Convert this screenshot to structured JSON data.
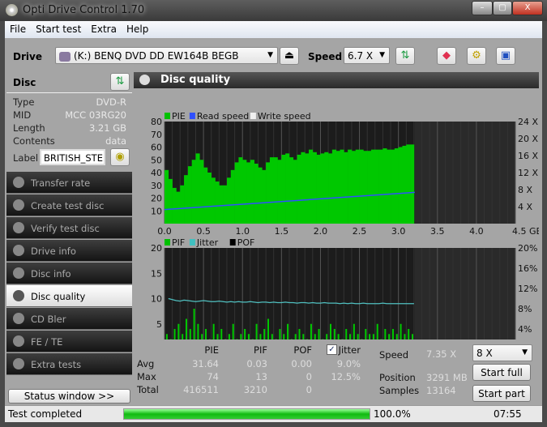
{
  "window": {
    "title": "Opti Drive Control 1.70",
    "min": "–",
    "max": "▢",
    "close": "X"
  },
  "menu": [
    "File",
    "Start test",
    "Extra",
    "Help"
  ],
  "toolbar": {
    "drive_label": "Drive",
    "drive_value": "(K:)   BENQ DVD DD EW164B BEGB",
    "speed_label": "Speed",
    "speed_value": "6.7 X"
  },
  "disc": {
    "title": "Disc",
    "rows": [
      {
        "k": "Type",
        "v": "DVD-R"
      },
      {
        "k": "MID",
        "v": "MCC 03RG20"
      },
      {
        "k": "Length",
        "v": "3.21 GB"
      },
      {
        "k": "Contents",
        "v": "data"
      }
    ],
    "label_label": "Label",
    "label_value": "BRITISH_STEEL"
  },
  "sidebar": {
    "items": [
      {
        "label": "Transfer rate"
      },
      {
        "label": "Create test disc"
      },
      {
        "label": "Verify test disc"
      },
      {
        "label": "Drive info"
      },
      {
        "label": "Disc info"
      },
      {
        "label": "Disc quality",
        "selected": true
      },
      {
        "label": "CD Bler"
      },
      {
        "label": "FE / TE"
      },
      {
        "label": "Extra tests"
      }
    ],
    "status_window": "Status window >>"
  },
  "panel": {
    "title": "Disc quality"
  },
  "chart_data": [
    {
      "type": "bar",
      "legend": [
        {
          "name": "PIE",
          "color": "#00c000"
        },
        {
          "name": "Read speed",
          "color": "#3050ff"
        },
        {
          "name": "Write speed",
          "color": "#f0f0f0"
        }
      ],
      "x": [
        0.05,
        0.1,
        0.15,
        0.2,
        0.25,
        0.3,
        0.35,
        0.4,
        0.45,
        0.5,
        0.55,
        0.6,
        0.65,
        0.7,
        0.75,
        0.8,
        0.85,
        0.9,
        0.95,
        1.0,
        1.05,
        1.1,
        1.15,
        1.2,
        1.25,
        1.3,
        1.35,
        1.4,
        1.45,
        1.5,
        1.55,
        1.6,
        1.65,
        1.7,
        1.75,
        1.8,
        1.85,
        1.9,
        1.95,
        2.0,
        2.05,
        2.1,
        2.15,
        2.2,
        2.25,
        2.3,
        2.35,
        2.4,
        2.45,
        2.5,
        2.55,
        2.6,
        2.65,
        2.7,
        2.75,
        2.8,
        2.85,
        2.9,
        2.95,
        3.0,
        3.05,
        3.1,
        3.15,
        3.2
      ],
      "pie": [
        42,
        35,
        28,
        25,
        30,
        38,
        45,
        50,
        55,
        50,
        44,
        40,
        36,
        33,
        30,
        30,
        36,
        42,
        48,
        52,
        50,
        48,
        50,
        47,
        44,
        42,
        48,
        52,
        52,
        50,
        54,
        55,
        52,
        50,
        54,
        56,
        55,
        58,
        56,
        54,
        55,
        56,
        55,
        58,
        57,
        58,
        56,
        58,
        57,
        58,
        58,
        57,
        57,
        58,
        58,
        58,
        59,
        58,
        58,
        59,
        60,
        61,
        62,
        62
      ],
      "read_speed": {
        "x": [
          0,
          3.21
        ],
        "y": [
          3.3,
          7.35
        ]
      },
      "xlim": [
        0,
        4.5
      ],
      "ylim": [
        0,
        80
      ],
      "y2lim": [
        0,
        24
      ],
      "xticks": [
        "0.0",
        "0.5",
        "1.0",
        "1.5",
        "2.0",
        "2.5",
        "3.0",
        "3.5",
        "4.0",
        "4.5 GB"
      ],
      "yticks": [
        "10",
        "20",
        "30",
        "40",
        "50",
        "60",
        "70",
        "80"
      ],
      "y2ticks": [
        "4 X",
        "8 X",
        "12 X",
        "16 X",
        "20 X",
        "24 X"
      ]
    },
    {
      "type": "bar",
      "legend": [
        {
          "name": "PIF",
          "color": "#00c000"
        },
        {
          "name": "Jitter",
          "color": "#40c0c0"
        },
        {
          "name": "POF",
          "color": "#000000"
        }
      ],
      "pif": [
        3,
        2,
        4,
        5,
        3,
        6,
        4,
        8,
        5,
        3,
        4,
        2,
        5,
        3,
        4,
        2,
        3,
        5,
        2,
        3,
        4,
        3,
        2,
        5,
        3,
        4,
        6,
        3,
        2,
        4,
        3,
        5,
        2,
        3,
        4,
        3,
        2,
        5,
        3,
        4,
        2,
        3,
        5,
        4,
        3,
        2,
        4,
        3,
        5,
        3,
        2,
        4,
        3,
        3,
        5,
        2,
        4,
        3,
        4,
        3,
        5,
        3,
        4,
        3
      ],
      "jitter": [
        10,
        9.8,
        9.6,
        9.5,
        9.7,
        9.6,
        9.5,
        9.4,
        9.5,
        9.6,
        9.5,
        9.4,
        9.4,
        9.5,
        9.4,
        9.3,
        9.4,
        9.3,
        9.4,
        9.3,
        9.3,
        9.4,
        9.3,
        9.2,
        9.3,
        9.3,
        9.2,
        9.3,
        9.2,
        9.2,
        9.3,
        9.2,
        9.2,
        9.1,
        9.2,
        9.2,
        9.1,
        9.2,
        9.1,
        9.1,
        9.2,
        9.1,
        9.1,
        9.1,
        9.0,
        9.1,
        9.0,
        9.1,
        9.0,
        9.0,
        9.1,
        9.0,
        9.0,
        9.0,
        9.0,
        9.1,
        9.0,
        9.0,
        9.0,
        9.0,
        9.0,
        9.0,
        9.0,
        9.0
      ],
      "xlim": [
        0,
        4.5
      ],
      "ylim": [
        0,
        20
      ],
      "y2lim": [
        0,
        20
      ],
      "xticks": [
        "0.0",
        "0.5",
        "1.0",
        "1.5",
        "2.0",
        "2.5",
        "3.0",
        "3.5",
        "4.0",
        "4.5 GB"
      ],
      "yticks": [
        "5",
        "10",
        "15",
        "20"
      ],
      "y2ticks": [
        "4%",
        "8%",
        "12%",
        "16%",
        "20%"
      ]
    }
  ],
  "stats": {
    "headers": [
      "PIE",
      "PIF",
      "POF",
      "Jitter"
    ],
    "jitter_checked": true,
    "rows": [
      {
        "k": "Avg",
        "v": [
          "31.64",
          "0.03",
          "0.00",
          "9.0%"
        ]
      },
      {
        "k": "Max",
        "v": [
          "74",
          "13",
          "0",
          "12.5%"
        ]
      },
      {
        "k": "Total",
        "v": [
          "416511",
          "3210",
          "0",
          ""
        ]
      }
    ],
    "speed_label": "Speed",
    "speed_value": "7.35 X",
    "position_label": "Position",
    "position_value": "3291 MB",
    "samples_label": "Samples",
    "samples_value": "13164",
    "speed_select": "8 X",
    "start_full": "Start full",
    "start_part": "Start part"
  },
  "status": {
    "text": "Test completed",
    "progress": 100.0,
    "progress_text": "100.0%",
    "time": "07:55"
  }
}
